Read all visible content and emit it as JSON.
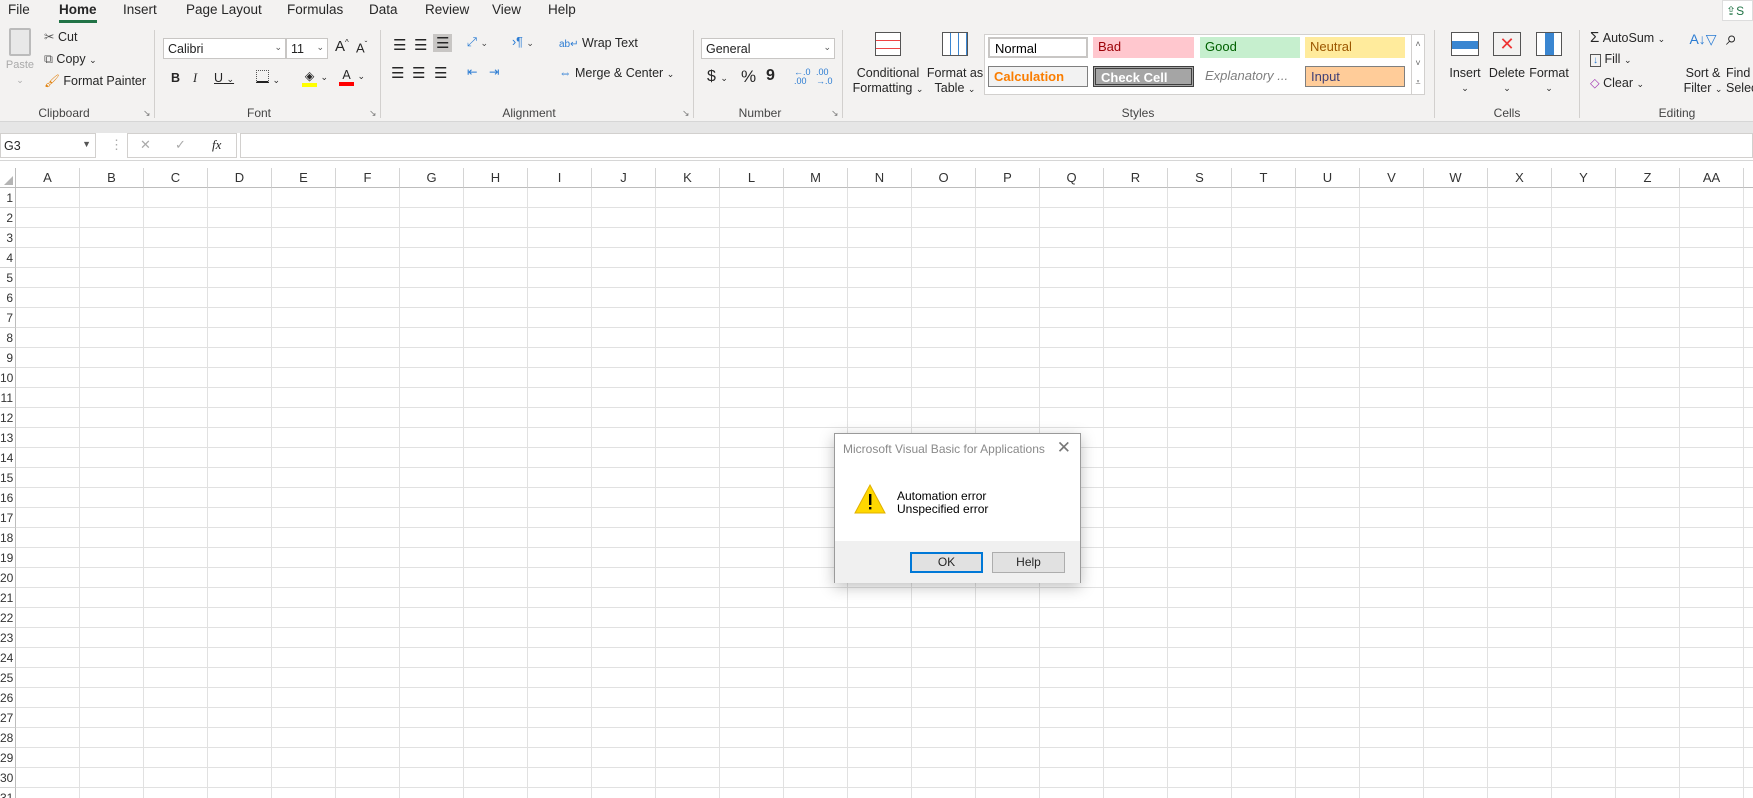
{
  "tabs": [
    "File",
    "Home",
    "Insert",
    "Page Layout",
    "Formulas",
    "Data",
    "Review",
    "View",
    "Help"
  ],
  "active_tab": "Home",
  "share_label": "S",
  "clipboard": {
    "paste": "Paste",
    "cut": "Cut",
    "copy": "Copy",
    "format_painter": "Format Painter",
    "label": "Clipboard"
  },
  "font": {
    "name": "Calibri",
    "size": "11",
    "bold": "B",
    "italic": "I",
    "underline": "U",
    "label": "Font",
    "grow": "A",
    "shrink": "A"
  },
  "alignment": {
    "wrap_text": "Wrap Text",
    "merge_center": "Merge & Center",
    "label": "Alignment"
  },
  "number": {
    "format": "General",
    "currency": "$",
    "percent": "%",
    "comma": "9",
    "label": "Number"
  },
  "styles": {
    "conditional_formatting": [
      "Conditional",
      "Formatting"
    ],
    "format_as_table": [
      "Format as",
      "Table"
    ],
    "cells": [
      "Normal",
      "Bad",
      "Good",
      "Neutral",
      "Calculation",
      "Check Cell",
      "Explanatory ...",
      "Input"
    ],
    "label": "Styles"
  },
  "cells_group": {
    "insert": "Insert",
    "delete": "Delete",
    "format": "Format",
    "label": "Cells"
  },
  "editing": {
    "autosum": "AutoSum",
    "fill": "Fill",
    "clear": "Clear",
    "sort_filter": [
      "Sort &",
      "Filter"
    ],
    "find_select": [
      "Find",
      "Selec"
    ],
    "label": "Editing"
  },
  "formula_bar": {
    "name_box": "G3",
    "cancel": "✕",
    "enter": "✓",
    "fx": "fx",
    "value": ""
  },
  "columns": [
    "A",
    "B",
    "C",
    "D",
    "E",
    "F",
    "G",
    "H",
    "I",
    "J",
    "K",
    "L",
    "M",
    "N",
    "O",
    "P",
    "Q",
    "R",
    "S",
    "T",
    "U",
    "V",
    "W",
    "X",
    "Y",
    "Z",
    "AA"
  ],
  "rows": 31,
  "dialog": {
    "title": "Microsoft Visual Basic for Applications",
    "line1": "Automation error",
    "line2": "Unspecified error",
    "ok": "OK",
    "help": "Help"
  }
}
